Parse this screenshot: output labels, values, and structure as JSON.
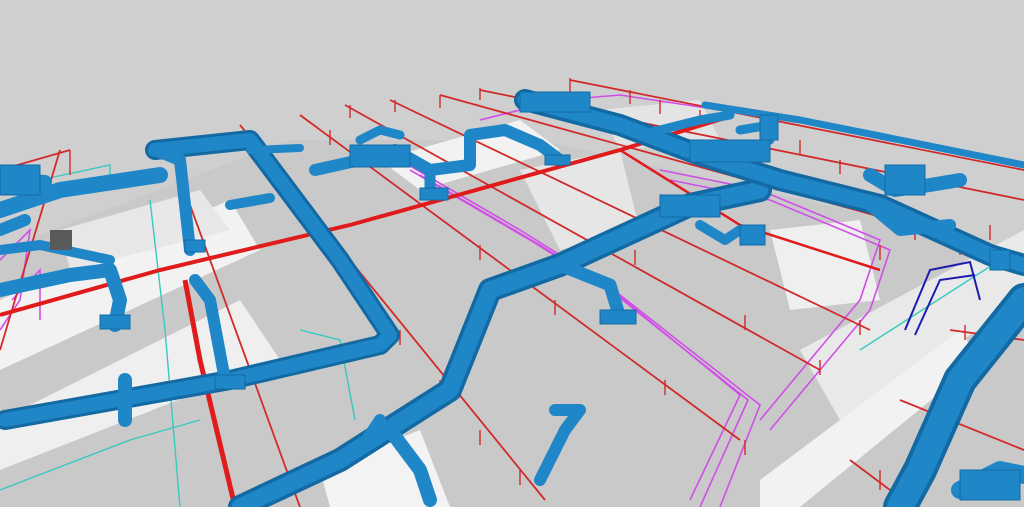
{
  "scene": {
    "description_visible_text": "",
    "colors": {
      "background": "#cfcfcf",
      "floor_highlight": "#f2f2f2",
      "floor_shadow": "#b9b9b9",
      "duct": "#1f86c8",
      "duct_dark": "#136aa3",
      "duct_light": "#3aa1e0",
      "fire_pipe": "#e01b1b",
      "fire_pipe_thin": "#d12a2a",
      "magenta_line": "#d14ee8",
      "navy_line": "#1c1cae",
      "cyan_line": "#36c9c0"
    }
  }
}
